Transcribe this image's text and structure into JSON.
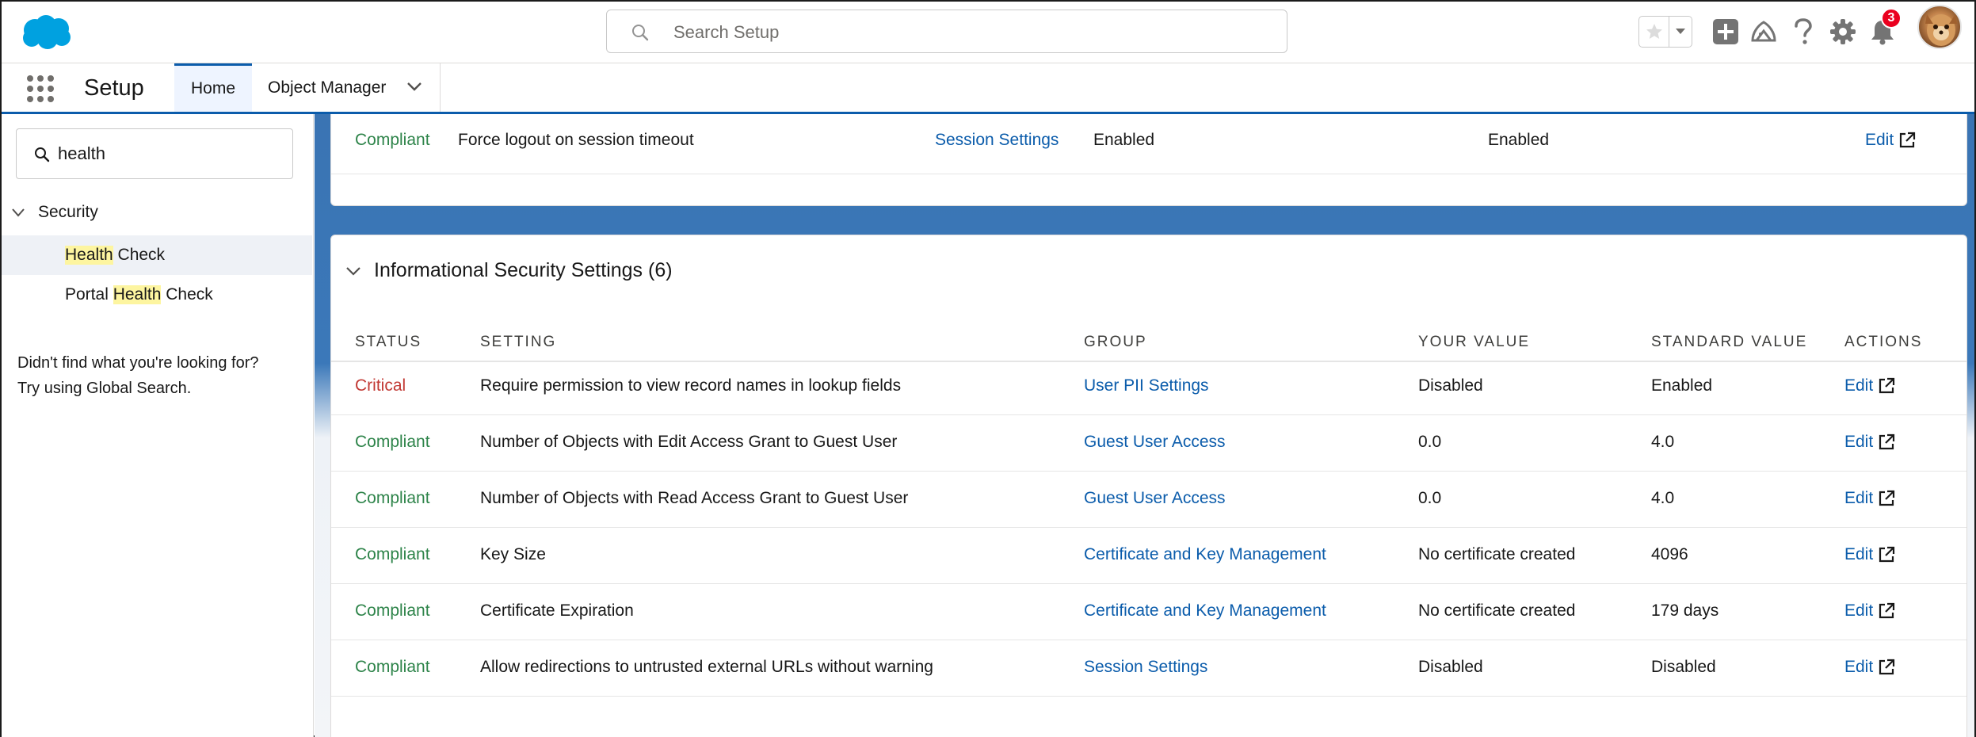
{
  "header": {
    "search_placeholder": "Search Setup",
    "notification_count": "3"
  },
  "context_bar": {
    "app_name": "Setup",
    "tabs": [
      {
        "label": "Home"
      },
      {
        "label": "Object Manager"
      }
    ]
  },
  "sidebar": {
    "quick_find_value": "health",
    "section": "Security",
    "items": [
      {
        "prefix": "",
        "highlight": "Health",
        "suffix": " Check"
      },
      {
        "prefix": "Portal ",
        "highlight": "Health",
        "suffix": " Check"
      }
    ],
    "help_line1": "Didn't find what you're looking for?",
    "help_line2": "Try using Global Search."
  },
  "top_row": {
    "status": "Compliant",
    "setting": "Force logout on session timeout",
    "group": "Session Settings",
    "your_value": "Enabled",
    "standard_value": "Enabled",
    "action": "Edit"
  },
  "informational": {
    "title": "Informational Security Settings (6)",
    "columns": [
      "STATUS",
      "SETTING",
      "GROUP",
      "YOUR VALUE",
      "STANDARD VALUE",
      "ACTIONS"
    ],
    "rows": [
      {
        "status": "Critical",
        "setting": "Require permission to view record names in lookup fields",
        "group": "User PII Settings",
        "your_value": "Disabled",
        "standard_value": "Enabled",
        "action": "Edit"
      },
      {
        "status": "Compliant",
        "setting": "Number of Objects with Edit Access Grant to Guest User",
        "group": "Guest User Access",
        "your_value": "0.0",
        "standard_value": "4.0",
        "action": "Edit"
      },
      {
        "status": "Compliant",
        "setting": "Number of Objects with Read Access Grant to Guest User",
        "group": "Guest User Access",
        "your_value": "0.0",
        "standard_value": "4.0",
        "action": "Edit"
      },
      {
        "status": "Compliant",
        "setting": "Key Size",
        "group": "Certificate and Key Management",
        "your_value": "No certificate created",
        "standard_value": "4096",
        "action": "Edit"
      },
      {
        "status": "Compliant",
        "setting": "Certificate Expiration",
        "group": "Certificate and Key Management",
        "your_value": "No certificate created",
        "standard_value": "179 days",
        "action": "Edit"
      },
      {
        "status": "Compliant",
        "setting": "Allow redirections to untrusted external URLs without warning",
        "group": "Session Settings",
        "your_value": "Disabled",
        "standard_value": "Disabled",
        "action": "Edit"
      }
    ]
  },
  "colors": {
    "brand_blue": "#0b5cab",
    "critical": "#c23934",
    "compliant": "#2e844a"
  }
}
